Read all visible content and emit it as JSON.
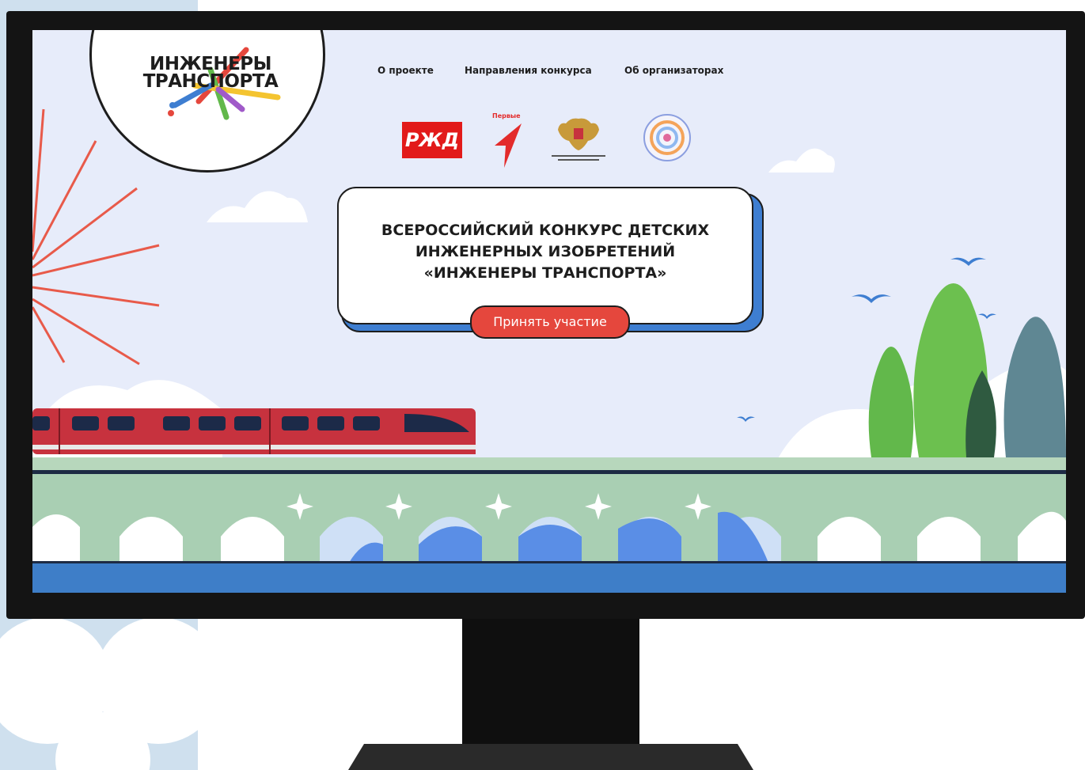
{
  "logo": {
    "line1": "ИНЖЕНЕРЫ",
    "line2": "ТРАНСПОРТА"
  },
  "nav": {
    "items": [
      {
        "label": "О проекте"
      },
      {
        "label": "Направления конкурса"
      },
      {
        "label": "Об организаторах"
      }
    ]
  },
  "partners": {
    "rzd_text": "РЖД",
    "pervye_label": "Первые",
    "ministry": "ministry-emblem",
    "round_logo": "round-logo"
  },
  "hero": {
    "line1": "ВСЕРОССИЙСКИЙ КОНКУРС ДЕТСКИХ",
    "line2": "ИНЖЕНЕРНЫХ ИЗОБРЕТЕНИЙ",
    "line3": "«ИНЖЕНЕРЫ ТРАНСПОРТА»"
  },
  "cta": {
    "label": "Принять участие"
  },
  "colors": {
    "accent": "#e5473d",
    "screen_bg": "#e7ecfa",
    "bridge": "#a9cfb3",
    "water": "#3e7ec8",
    "train": "#c7323e"
  }
}
